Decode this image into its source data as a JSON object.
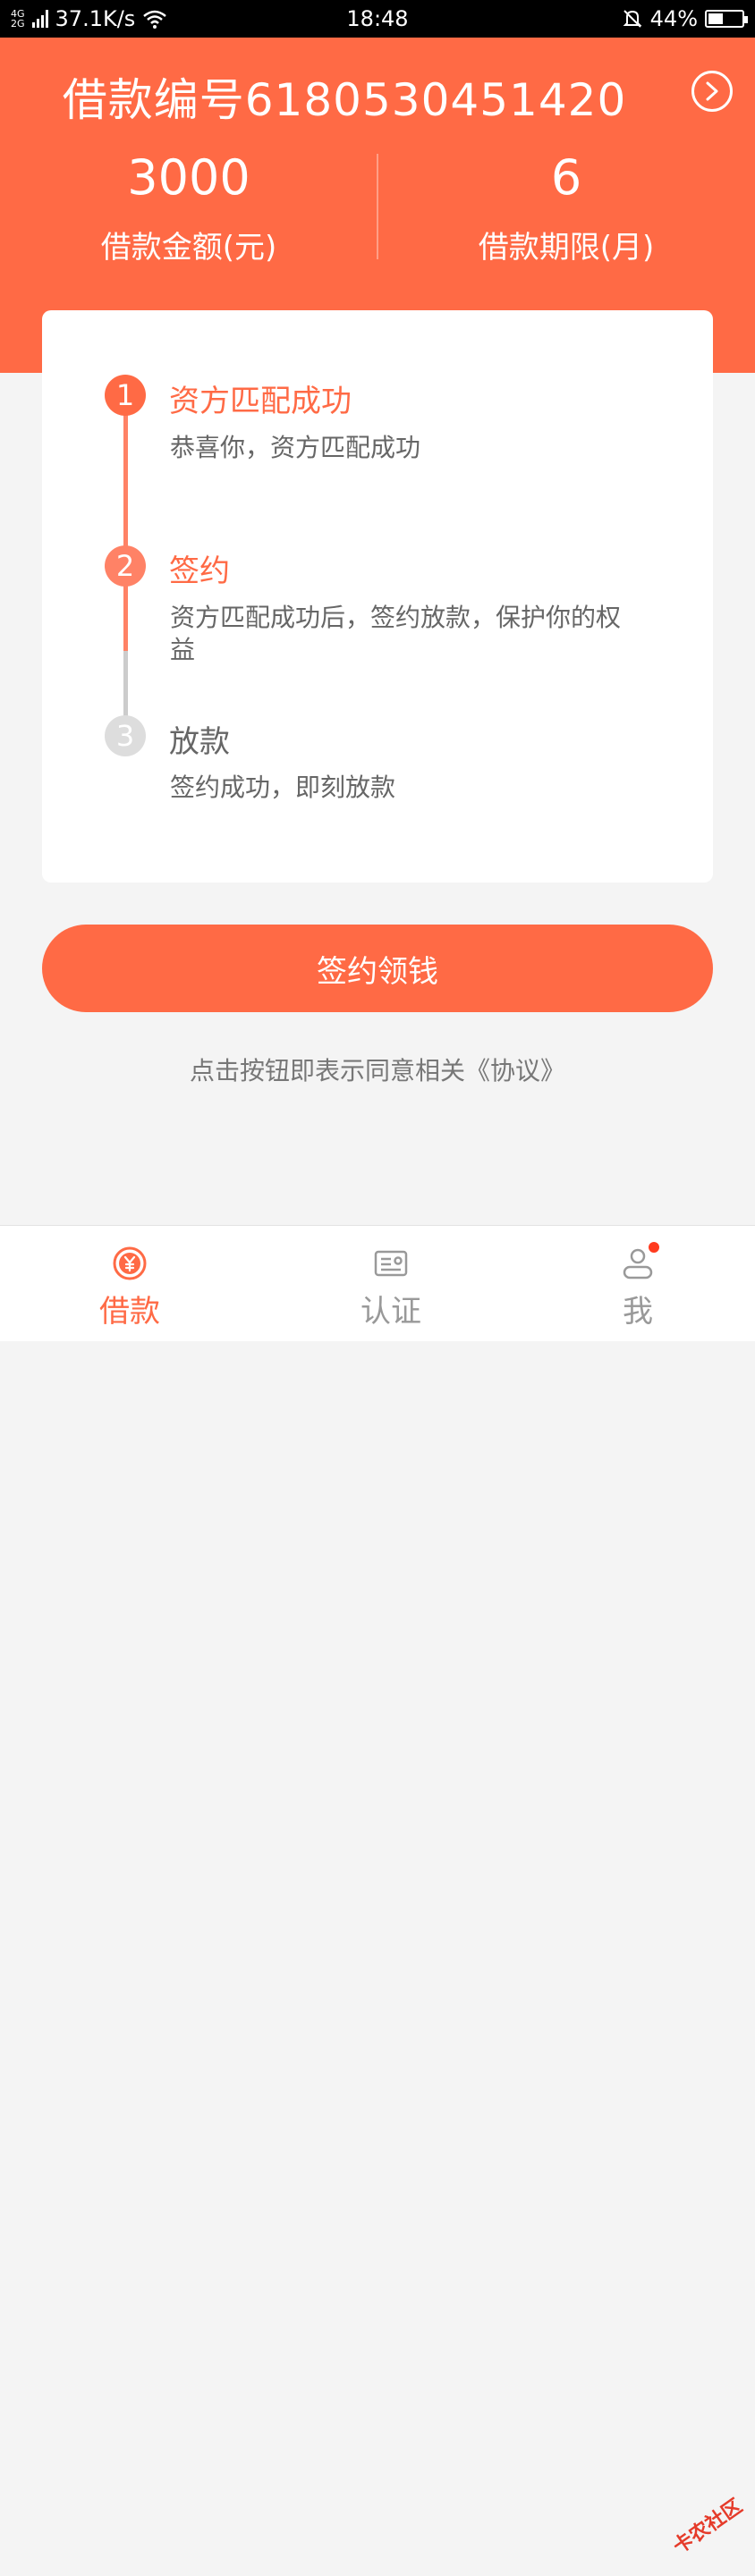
{
  "status_bar": {
    "network_top": "4G",
    "network_bottom": "2G",
    "speed": "37.1K/s",
    "time": "18:48",
    "battery_percent": "44%",
    "battery_level": 0.44
  },
  "header": {
    "loan_number": "借款编号61805304514​20",
    "amount_value": "3000",
    "amount_label": "借款金额(元)",
    "term_value": "6",
    "term_label": "借款期限(月)"
  },
  "steps": [
    {
      "number": "1",
      "title": "资方匹配成功",
      "desc": "恭喜你，资方匹配成功",
      "state": "done"
    },
    {
      "number": "2",
      "title": "签约",
      "desc": "资方匹配成功后，签约放款，保护你的权益",
      "state": "current"
    },
    {
      "number": "3",
      "title": "放款",
      "desc": "签约成功，即刻放款",
      "state": "pending"
    }
  ],
  "actions": {
    "sign_button": "签约领钱",
    "agreement_prefix": "点击按钮即表示同意相关",
    "agreement_link": "《协议》"
  },
  "tabs": [
    {
      "label": "借款",
      "icon": "yuan-coin-icon",
      "active": true
    },
    {
      "label": "认证",
      "icon": "id-card-icon",
      "active": false
    },
    {
      "label": "我",
      "icon": "user-icon",
      "active": false
    }
  ],
  "watermark": "卡农社区",
  "colors": {
    "accent": "#ff6a45",
    "inactive": "#cccccc",
    "background": "#f4f4f4"
  }
}
